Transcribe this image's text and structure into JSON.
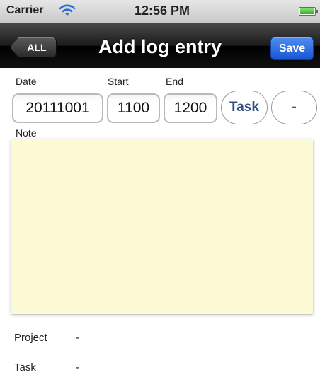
{
  "status_bar": {
    "carrier": "Carrier",
    "time": "12:56 PM",
    "icons": [
      "wifi-icon",
      "battery-icon"
    ]
  },
  "nav_bar": {
    "back_label": "ALL",
    "title": "Add log entry",
    "save_label": "Save",
    "save_color": "#2a6ae0"
  },
  "form": {
    "date_label": "Date",
    "start_label": "Start",
    "end_label": "End",
    "date_value": "20111001",
    "start_value": "1100",
    "end_value": "1200",
    "task_button_label": "Task",
    "minus_button_label": "-",
    "note_label": "Note",
    "note_value": "",
    "note_background": "#fdfad6"
  },
  "info": {
    "project_label": "Project",
    "project_value": "-",
    "task_label": "Task",
    "task_value": "-"
  }
}
